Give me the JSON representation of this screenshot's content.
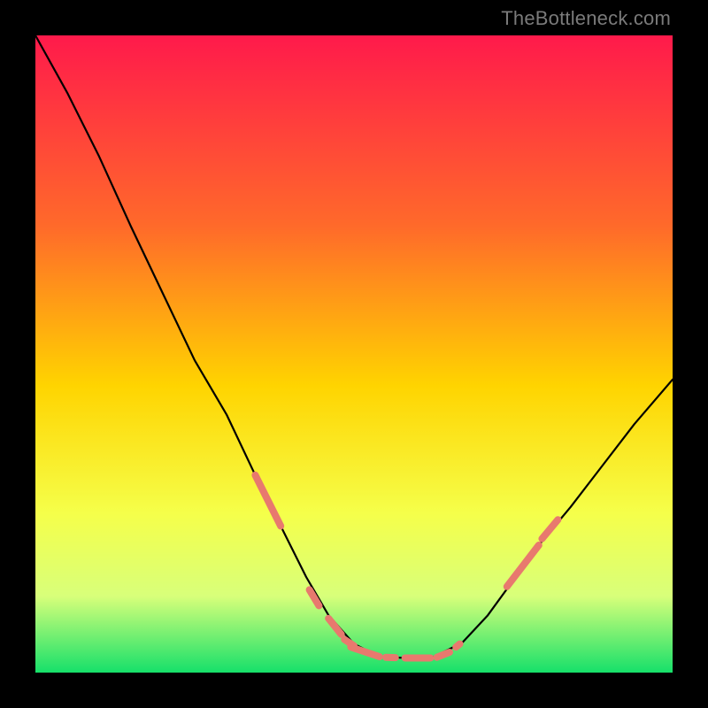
{
  "watermark": "TheBottleneck.com",
  "chart_data": {
    "type": "line",
    "title": "",
    "xlabel": "",
    "ylabel": "",
    "xlim": [
      0,
      100
    ],
    "ylim": [
      0,
      100
    ],
    "grid": false,
    "legend": false,
    "gradient_stops": [
      {
        "offset": 0,
        "color": "#ff1a4b"
      },
      {
        "offset": 30,
        "color": "#ff6a2a"
      },
      {
        "offset": 55,
        "color": "#ffd400"
      },
      {
        "offset": 75,
        "color": "#f5ff4a"
      },
      {
        "offset": 88,
        "color": "#d8ff7a"
      },
      {
        "offset": 100,
        "color": "#16e06a"
      }
    ],
    "series": [
      {
        "name": "bottleneck-curve",
        "color": "#000000",
        "x": [
          0,
          5,
          10,
          15,
          20,
          25,
          30,
          34.5,
          38.5,
          42.5,
          46,
          50,
          54,
          58,
          62,
          67,
          71,
          75,
          79,
          84,
          89,
          94,
          100
        ],
        "y": [
          100,
          91,
          81,
          70,
          59.5,
          49,
          40.5,
          31,
          23,
          15,
          9,
          4.5,
          2.5,
          2.3,
          2.2,
          4.7,
          9,
          14.5,
          20,
          26,
          32.5,
          39,
          46
        ]
      }
    ],
    "highlight_segments": {
      "name": "highlight-dots",
      "color": "#e8796e",
      "thickness": 8,
      "segments": [
        {
          "x1": 34.5,
          "y1": 31,
          "x2": 38.5,
          "y2": 23
        },
        {
          "x1": 43,
          "y1": 13,
          "x2": 44.5,
          "y2": 10.5
        },
        {
          "x1": 46,
          "y1": 8.5,
          "x2": 48,
          "y2": 6
        },
        {
          "x1": 48.5,
          "y1": 5.2,
          "x2": 50,
          "y2": 4.2
        },
        {
          "x1": 49.5,
          "y1": 4,
          "x2": 54,
          "y2": 2.5
        },
        {
          "x1": 55,
          "y1": 2.4,
          "x2": 56.5,
          "y2": 2.35
        },
        {
          "x1": 58,
          "y1": 2.3,
          "x2": 62,
          "y2": 2.3
        },
        {
          "x1": 63,
          "y1": 2.4,
          "x2": 65,
          "y2": 3.2
        },
        {
          "x1": 66,
          "y1": 4,
          "x2": 66.6,
          "y2": 4.5
        },
        {
          "x1": 74,
          "y1": 13.5,
          "x2": 79,
          "y2": 20
        },
        {
          "x1": 79.5,
          "y1": 21,
          "x2": 82,
          "y2": 24
        }
      ]
    }
  }
}
